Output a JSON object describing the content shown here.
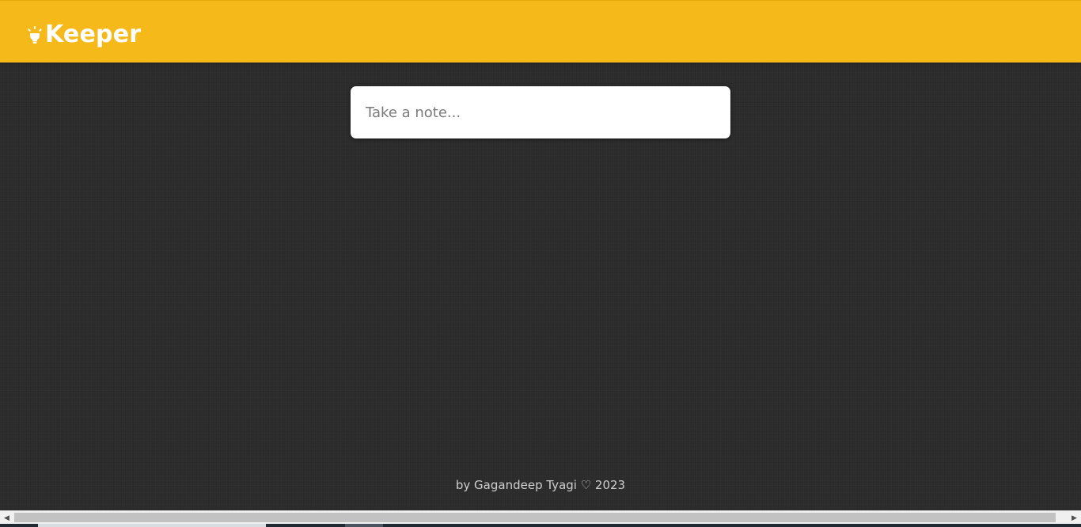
{
  "header": {
    "brand_text": "Keeper",
    "brand_icon": "lightbulb-icon",
    "accent_color": "#f5ba1a"
  },
  "note_form": {
    "placeholder": "Take a note..."
  },
  "footer": {
    "text": "by Gagandeep Tyagi ♡ 2023"
  },
  "scrollbar": {
    "left_arrow": "◀",
    "right_arrow": "▶"
  },
  "colors": {
    "background": "#2b2b2b",
    "footer_text": "#cfcfcf"
  }
}
